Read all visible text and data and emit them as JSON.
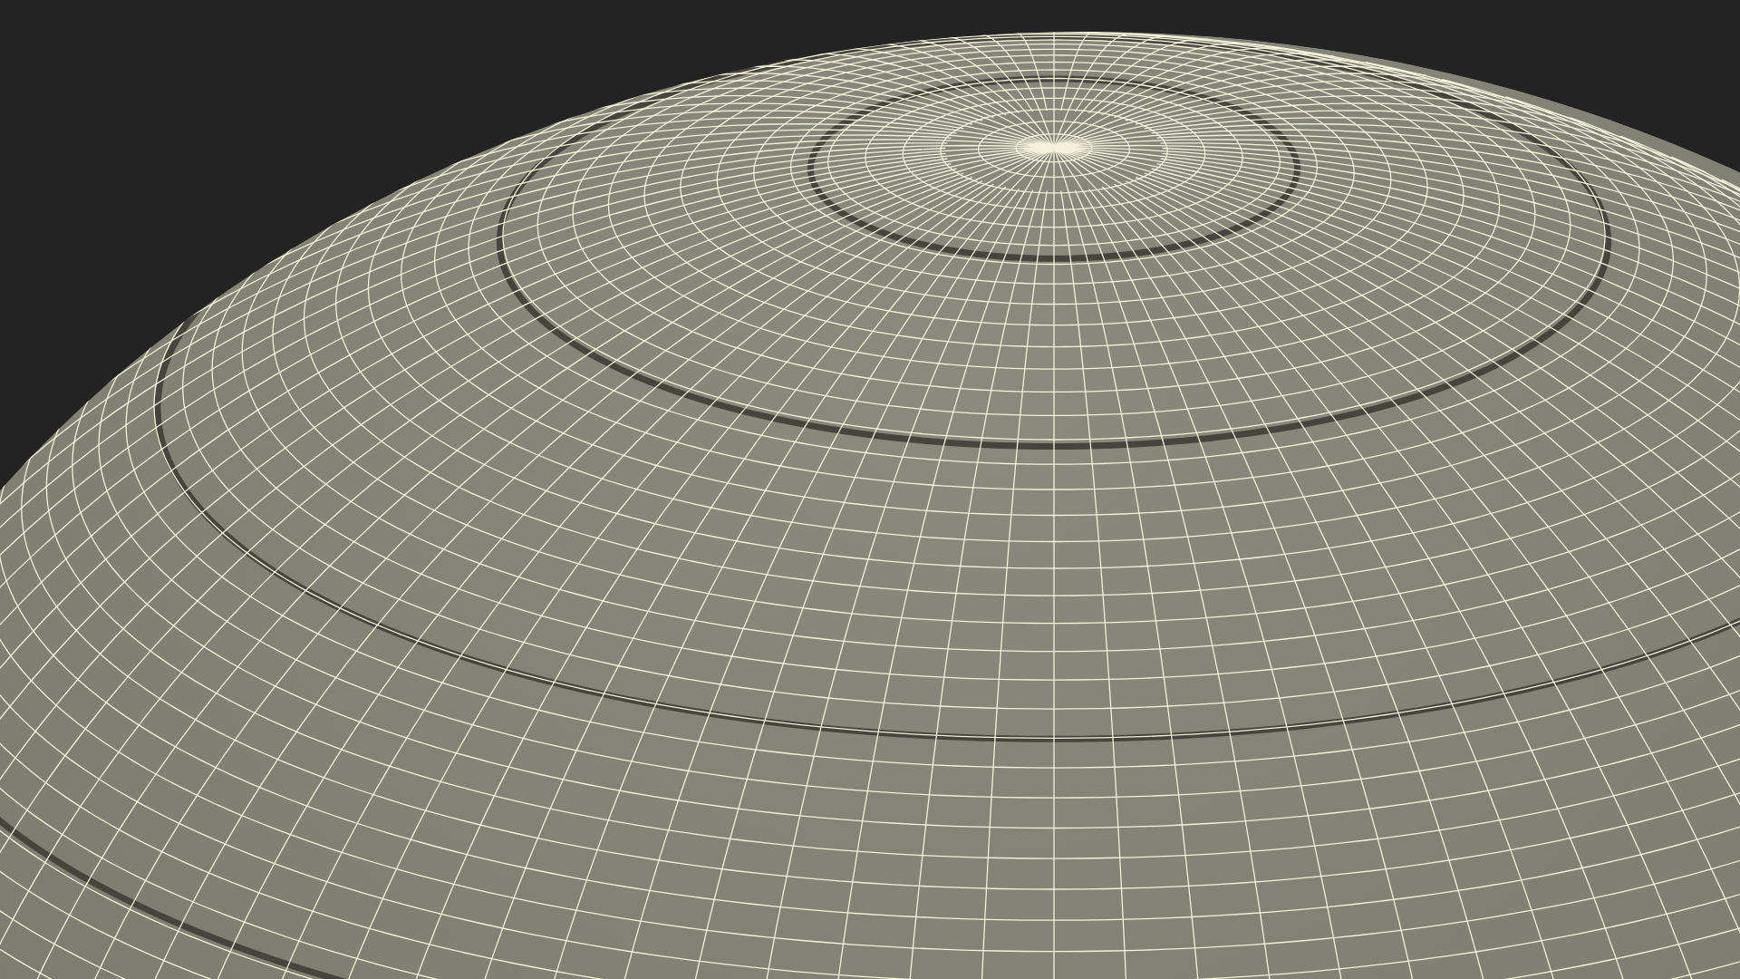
{
  "scene": {
    "kind": "wireframe-dome"
  }
}
